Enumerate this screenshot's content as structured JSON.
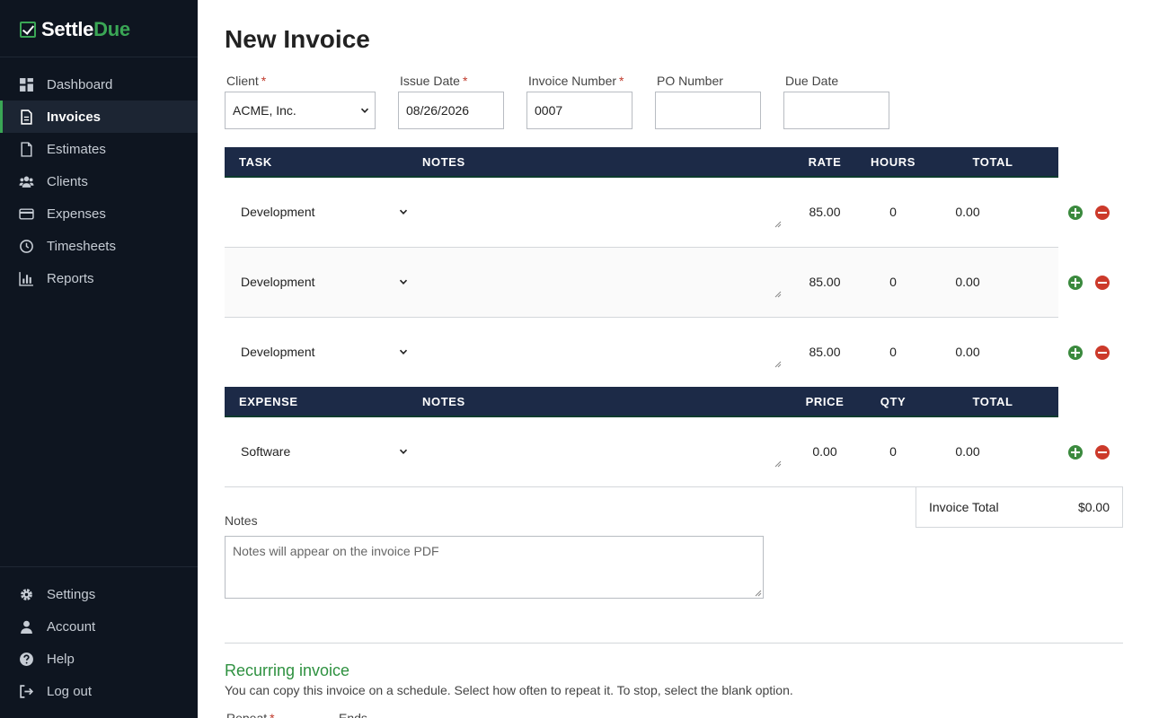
{
  "brand": {
    "part1": "Settle",
    "part2": "Due",
    "accent": "#3aa655"
  },
  "sidebar": {
    "items": [
      {
        "label": "Dashboard",
        "icon": "dashboard-icon"
      },
      {
        "label": "Invoices",
        "icon": "document-icon",
        "active": true
      },
      {
        "label": "Estimates",
        "icon": "file-icon"
      },
      {
        "label": "Clients",
        "icon": "users-icon"
      },
      {
        "label": "Expenses",
        "icon": "credit-card-icon"
      },
      {
        "label": "Timesheets",
        "icon": "clock-icon"
      },
      {
        "label": "Reports",
        "icon": "bar-chart-icon"
      }
    ],
    "bottom_items": [
      {
        "label": "Settings",
        "icon": "gear-icon"
      },
      {
        "label": "Account",
        "icon": "user-icon"
      },
      {
        "label": "Help",
        "icon": "question-icon"
      },
      {
        "label": "Log out",
        "icon": "logout-icon"
      }
    ]
  },
  "page": {
    "title": "New Invoice"
  },
  "form": {
    "client": {
      "label": "Client",
      "value": "ACME, Inc."
    },
    "issue_date": {
      "label": "Issue Date",
      "value": "08/26/2026"
    },
    "invoice_number": {
      "label": "Invoice Number",
      "value": "0007"
    },
    "po_number": {
      "label": "PO Number",
      "value": ""
    },
    "due_date": {
      "label": "Due Date",
      "value": ""
    }
  },
  "tasks": {
    "headers": {
      "task": "TASK",
      "notes": "NOTES",
      "rate": "RATE",
      "hours": "HOURS",
      "total": "TOTAL"
    },
    "rows": [
      {
        "task": "Development",
        "notes": "",
        "rate": "85.00",
        "hours": "0",
        "total": "0.00"
      },
      {
        "task": "Development",
        "notes": "",
        "rate": "85.00",
        "hours": "0",
        "total": "0.00"
      },
      {
        "task": "Development",
        "notes": "",
        "rate": "85.00",
        "hours": "0",
        "total": "0.00"
      }
    ]
  },
  "expenses": {
    "headers": {
      "expense": "EXPENSE",
      "notes": "NOTES",
      "price": "PRICE",
      "qty": "QTY",
      "total": "TOTAL"
    },
    "rows": [
      {
        "expense": "Software",
        "notes": "",
        "price": "0.00",
        "qty": "0",
        "total": "0.00"
      }
    ]
  },
  "invoice_total": {
    "label": "Invoice Total",
    "value": "$0.00"
  },
  "notes": {
    "label": "Notes",
    "placeholder": "Notes will appear on the invoice PDF"
  },
  "recurring": {
    "title": "Recurring invoice",
    "description": "You can copy this invoice on a schedule. Select how often to repeat it. To stop, select the blank option.",
    "repeat_label": "Repeat",
    "ends_label": "Ends"
  },
  "colors": {
    "sidebar_bg": "#0e1520",
    "table_header_bg": "#1c2a47",
    "add": "#3b8a3e",
    "remove": "#cc3a2b",
    "required": "#c0392b"
  }
}
